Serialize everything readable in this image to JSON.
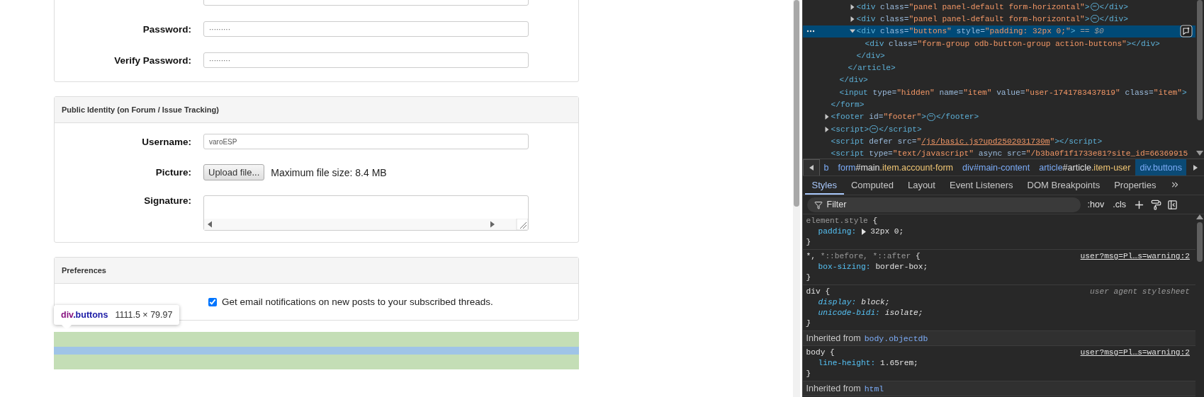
{
  "account_panel": {
    "fields": [
      {
        "label": "Password:",
        "value": "·········"
      },
      {
        "label": "Verify Password:",
        "value": "·········"
      }
    ]
  },
  "identity_panel": {
    "title": "Public Identity (on Forum / Issue Tracking)",
    "username": {
      "label": "Username:",
      "value": "varoESP"
    },
    "picture": {
      "label": "Picture:",
      "button": "Upload file...",
      "hint": "Maximum file size: 8.4 MB"
    },
    "signature": {
      "label": "Signature:"
    }
  },
  "preferences_panel": {
    "title": "Preferences",
    "notifications": {
      "label": "Get email notifications on new posts to your subscribed threads.",
      "checked": true
    }
  },
  "inspect_tooltip": {
    "tag": "div",
    "class": ".buttons",
    "size": "1111.5 × 79.97"
  },
  "devtools": {
    "dom_tree": [
      {
        "children": [
          {
            "children": [
              {
                "children": [
                  {
                    "open": [
                      {
                        "kind": "tag",
                        "text": "<div"
                      },
                      {
                        "kind": "attr",
                        "text": " class"
                      },
                      {
                        "kind": "eq",
                        "text": "="
                      },
                      {
                        "kind": "value",
                        "text": "\"panel panel-default form-horizontal\""
                      },
                      {
                        "kind": "tag",
                        "text": ">"
                      },
                      {
                        "kind": "ellipsis",
                        "text": "⋯"
                      },
                      {
                        "kind": "tag",
                        "text": "</div>"
                      }
                    ],
                    "expanded": false,
                    "selected": false
                  },
                  {
                    "open": [
                      {
                        "kind": "tag",
                        "text": "<div"
                      },
                      {
                        "kind": "attr",
                        "text": " class"
                      },
                      {
                        "kind": "eq",
                        "text": "="
                      },
                      {
                        "kind": "value",
                        "text": "\"panel panel-default form-horizontal\""
                      },
                      {
                        "kind": "tag",
                        "text": ">"
                      },
                      {
                        "kind": "ellipsis",
                        "text": "⋯"
                      },
                      {
                        "kind": "tag",
                        "text": "</div>"
                      }
                    ],
                    "expanded": false,
                    "selected": false
                  },
                  {
                    "open": [
                      {
                        "kind": "tag",
                        "text": "<div"
                      },
                      {
                        "kind": "attr",
                        "text": " class"
                      },
                      {
                        "kind": "eq",
                        "text": "="
                      },
                      {
                        "kind": "value",
                        "text": "\"buttons\""
                      },
                      {
                        "kind": "attr",
                        "text": " style"
                      },
                      {
                        "kind": "eq",
                        "text": "="
                      },
                      {
                        "kind": "value",
                        "text": "\"padding: 32px 0;\""
                      },
                      {
                        "kind": "tag",
                        "text": ">"
                      },
                      {
                        "kind": "marker",
                        "text": " == $0"
                      }
                    ],
                    "expanded": true,
                    "selected": true,
                    "children": [
                      {
                        "open": [
                          {
                            "kind": "tag",
                            "text": "<div"
                          },
                          {
                            "kind": "attr",
                            "text": " class"
                          },
                          {
                            "kind": "eq",
                            "text": "="
                          },
                          {
                            "kind": "value",
                            "text": "\"form-group odb-button-group action-buttons\""
                          },
                          {
                            "kind": "tag",
                            "text": "></div>"
                          }
                        ],
                        "selected": false
                      }
                    ],
                    "close": [
                      {
                        "kind": "tag",
                        "text": "</div>"
                      }
                    ]
                  }
                ],
                "close": [
                  {
                    "kind": "tag",
                    "text": "</article>"
                  }
                ]
              }
            ],
            "close": [
              {
                "kind": "tag",
                "text": "</div>"
              }
            ]
          },
          {
            "open": [
              {
                "kind": "tag",
                "text": "<input"
              },
              {
                "kind": "attr",
                "text": " type"
              },
              {
                "kind": "eq",
                "text": "="
              },
              {
                "kind": "value",
                "text": "\"hidden\""
              },
              {
                "kind": "attr",
                "text": " name"
              },
              {
                "kind": "eq",
                "text": "="
              },
              {
                "kind": "value",
                "text": "\"item\""
              },
              {
                "kind": "attr",
                "text": " value"
              },
              {
                "kind": "eq",
                "text": "="
              },
              {
                "kind": "value",
                "text": "\"user-1741783437819\""
              },
              {
                "kind": "attr",
                "text": " class"
              },
              {
                "kind": "eq",
                "text": "="
              },
              {
                "kind": "value",
                "text": "\"item\""
              },
              {
                "kind": "tag",
                "text": ">"
              }
            ],
            "selected": false
          }
        ],
        "close": [
          {
            "kind": "tag",
            "text": "</form>"
          }
        ]
      },
      {
        "open": [
          {
            "kind": "tag",
            "text": "<footer"
          },
          {
            "kind": "attr",
            "text": " id"
          },
          {
            "kind": "eq",
            "text": "="
          },
          {
            "kind": "value",
            "text": "\"footer\""
          },
          {
            "kind": "tag",
            "text": ">"
          },
          {
            "kind": "ellipsis",
            "text": "⋯"
          },
          {
            "kind": "tag",
            "text": "</footer>"
          }
        ],
        "expanded": false,
        "selected": false
      },
      {
        "open": [
          {
            "kind": "tag",
            "text": "<script>"
          },
          {
            "kind": "ellipsis",
            "text": "⋯"
          },
          {
            "kind": "tag",
            "text": "</script>"
          }
        ],
        "expanded": false,
        "selected": false
      },
      {
        "open": [
          {
            "kind": "tag",
            "text": "<script"
          },
          {
            "kind": "attr",
            "text": " defer"
          },
          {
            "kind": "attr",
            "text": " src"
          },
          {
            "kind": "eq",
            "text": "="
          },
          {
            "kind": "value",
            "text": "\""
          },
          {
            "kind": "link",
            "text": "/js/basic.js?upd2502031730m"
          },
          {
            "kind": "value",
            "text": "\""
          },
          {
            "kind": "tag",
            "text": "></script>"
          }
        ],
        "selected": false
      },
      {
        "open": [
          {
            "kind": "tag",
            "text": "<script"
          },
          {
            "kind": "attr",
            "text": " type"
          },
          {
            "kind": "eq",
            "text": "="
          },
          {
            "kind": "value",
            "text": "\"text/javascript\""
          },
          {
            "kind": "attr",
            "text": " async"
          },
          {
            "kind": "attr",
            "text": " src"
          },
          {
            "kind": "eq",
            "text": "="
          },
          {
            "kind": "value",
            "text": "\"/b3ba0f1f1733e81?site_id=66369915"
          }
        ],
        "selected": false
      }
    ],
    "breadcrumbs": [
      {
        "parts": [
          {
            "kind": "tag",
            "text": "b"
          }
        ],
        "selected": false
      },
      {
        "parts": [
          {
            "kind": "tag",
            "text": "form"
          },
          {
            "kind": "id",
            "text": "#main"
          },
          {
            "kind": "class",
            "text": ".item.account-form"
          }
        ],
        "selected": false
      },
      {
        "parts": [
          {
            "kind": "tag",
            "text": "div#main-content"
          }
        ],
        "selected": false
      },
      {
        "parts": [
          {
            "kind": "tag",
            "text": "article"
          },
          {
            "kind": "id",
            "text": "#article"
          },
          {
            "kind": "class",
            "text": ".item-user"
          }
        ],
        "selected": false
      },
      {
        "parts": [
          {
            "kind": "tag",
            "text": "div.buttons"
          }
        ],
        "selected": true
      }
    ],
    "tabs": [
      {
        "label": "Styles",
        "selected": true
      },
      {
        "label": "Computed",
        "selected": false
      },
      {
        "label": "Layout",
        "selected": false
      },
      {
        "label": "Event Listeners",
        "selected": false
      },
      {
        "label": "DOM Breakpoints",
        "selected": false
      },
      {
        "label": "Properties",
        "selected": false
      }
    ],
    "filter": {
      "placeholder": "Filter"
    },
    "toolbar_buttons": [
      ":hov",
      ".cls"
    ],
    "styles": [
      {
        "kind": "rule",
        "selector": [
          {
            "text": "element.style",
            "matched": false
          },
          {
            "text": " {",
            "matched": true
          }
        ],
        "declarations": [
          {
            "property": "padding:",
            "value": "32px 0;",
            "expandable": true
          }
        ],
        "close": "}"
      },
      {
        "kind": "rule",
        "selector": [
          {
            "text": "*,",
            "matched": true
          },
          {
            "text": " *::before, *::after",
            "matched": false
          },
          {
            "text": " {",
            "matched": true
          }
        ],
        "source": {
          "text": "user?msg=Pl…s=warning:2",
          "kind": "link"
        },
        "declarations": [
          {
            "property": "box-sizing:",
            "value": "border-box;",
            "expandable": false
          }
        ],
        "close": "}"
      },
      {
        "kind": "rule",
        "user_agent": true,
        "selector": [
          {
            "text": "div {",
            "matched": true
          }
        ],
        "source": {
          "text": "user agent stylesheet",
          "kind": "note"
        },
        "declarations": [
          {
            "property": "display:",
            "value": "block;",
            "expandable": false
          },
          {
            "property": "unicode-bidi:",
            "value": "isolate;",
            "expandable": false
          }
        ],
        "close": "}"
      },
      {
        "kind": "inherited",
        "label": "Inherited from",
        "element": "body.objectdb"
      },
      {
        "kind": "rule",
        "selector": [
          {
            "text": "body {",
            "matched": true
          }
        ],
        "source": {
          "text": "user?msg=Pl…s=warning:2",
          "kind": "link"
        },
        "declarations": [
          {
            "property": "line-height:",
            "value": "1.65rem;",
            "expandable": false
          }
        ],
        "close": "}"
      },
      {
        "kind": "inherited",
        "label": "Inherited from",
        "element": "html"
      }
    ]
  }
}
